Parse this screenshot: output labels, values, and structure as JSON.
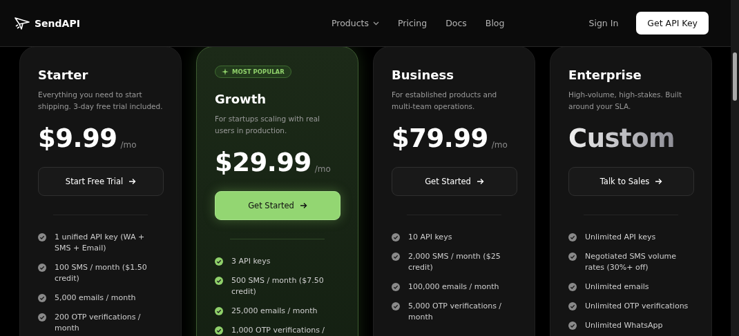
{
  "nav": {
    "brand": "SendAPI",
    "links": [
      {
        "label": "Products",
        "dropdown": true
      },
      {
        "label": "Pricing",
        "dropdown": false
      },
      {
        "label": "Docs",
        "dropdown": false
      },
      {
        "label": "Blog",
        "dropdown": false
      }
    ],
    "sign_in": "Sign In",
    "cta": "Get API Key"
  },
  "plans": [
    {
      "name": "Starter",
      "highlighted": false,
      "description": "Everything you need to start shipping. 3-day free trial included.",
      "price": "$9.99",
      "period": "/mo",
      "button": "Start Free Trial",
      "features": [
        "1 unified API key (WA + SMS + Email)",
        "100 SMS / month ($1.50 credit)",
        "5,000 emails / month",
        "200 OTP verifications / month"
      ]
    },
    {
      "name": "Growth",
      "highlighted": true,
      "badge": "MOST POPULAR",
      "description": "For startups scaling with real users in production.",
      "price": "$29.99",
      "period": "/mo",
      "button": "Get Started",
      "features": [
        "3 API keys",
        "500 SMS / month ($7.50 credit)",
        "25,000 emails / month",
        "1,000 OTP verifications /"
      ]
    },
    {
      "name": "Business",
      "highlighted": false,
      "description": "For established products and multi-team operations.",
      "price": "$79.99",
      "period": "/mo",
      "button": "Get Started",
      "features": [
        "10 API keys",
        "2,000 SMS / month ($25 credit)",
        "100,000 emails / month",
        "5,000 OTP verifications / month"
      ]
    },
    {
      "name": "Enterprise",
      "highlighted": false,
      "description": "High-volume, high-stakes. Built around your SLA.",
      "price": "Custom",
      "button": "Talk to Sales",
      "features": [
        "Unlimited API keys",
        "Negotiated SMS volume rates (30%+ off)",
        "Unlimited emails",
        "Unlimited OTP verifications",
        "Unlimited WhatsApp"
      ]
    }
  ]
}
